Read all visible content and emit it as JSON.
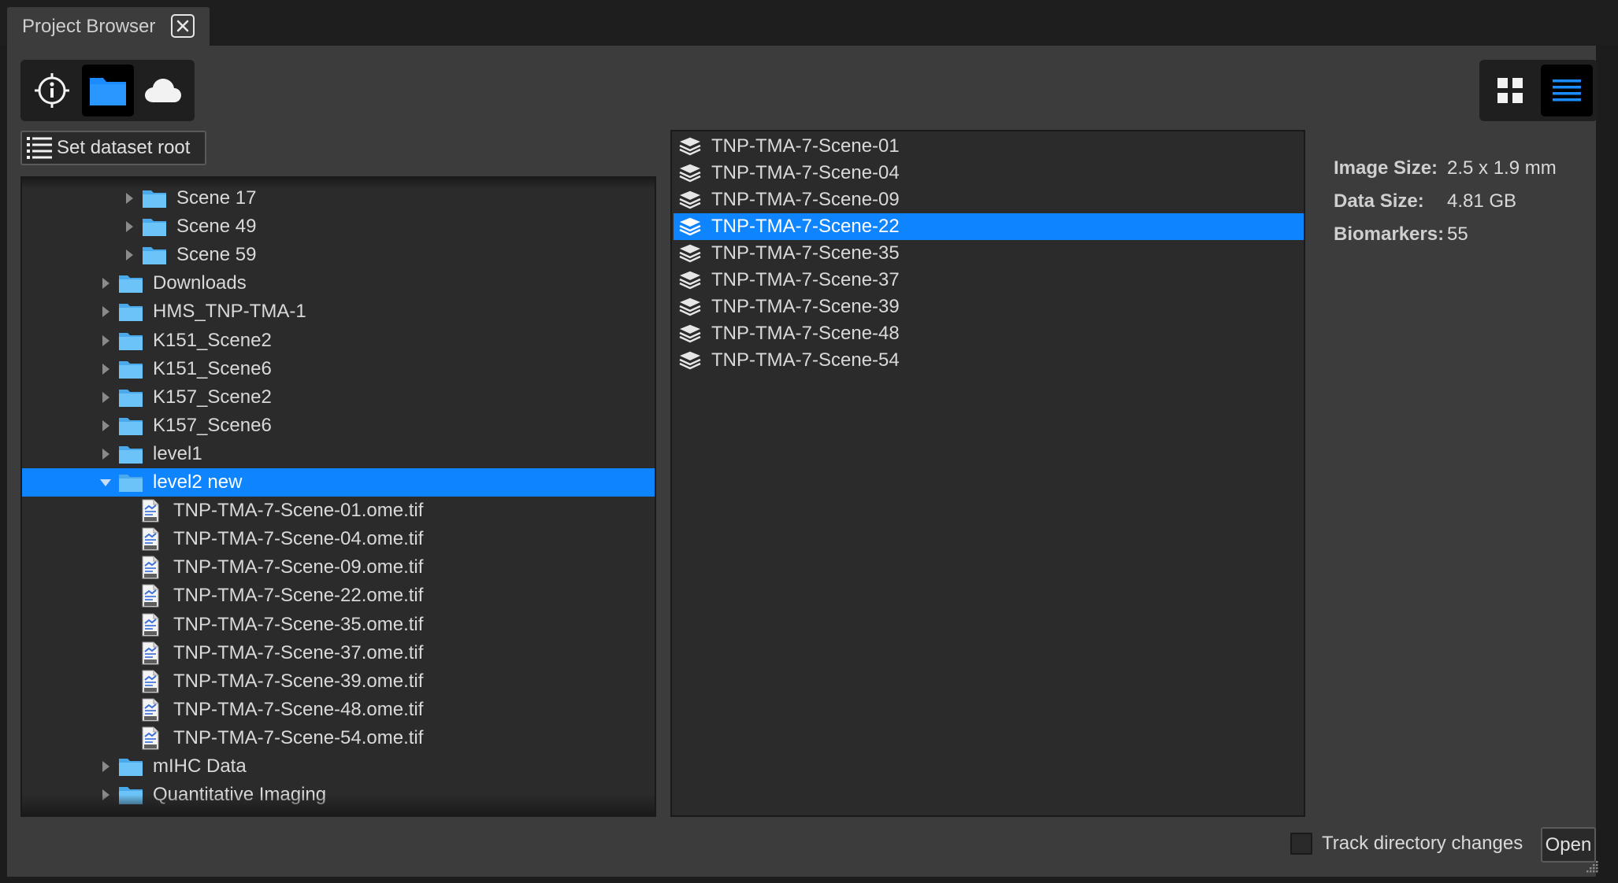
{
  "tab": {
    "title": "Project Browser"
  },
  "toolbar": {
    "modes": [
      {
        "icon": "info-target-icon",
        "active": false
      },
      {
        "icon": "folder-icon",
        "active": true
      },
      {
        "icon": "cloud-icon",
        "active": false
      }
    ],
    "views": [
      {
        "icon": "grid-view-icon",
        "active": false
      },
      {
        "icon": "list-view-icon",
        "active": true
      }
    ],
    "set_root_label": "Set dataset root"
  },
  "tree": {
    "items": [
      {
        "label": "Scene 17",
        "type": "folder",
        "depth": 2,
        "expanded": false,
        "selected": false
      },
      {
        "label": "Scene 49",
        "type": "folder",
        "depth": 2,
        "expanded": false,
        "selected": false
      },
      {
        "label": "Scene 59",
        "type": "folder",
        "depth": 2,
        "expanded": false,
        "selected": false
      },
      {
        "label": "Downloads",
        "type": "folder",
        "depth": 1,
        "expanded": false,
        "selected": false
      },
      {
        "label": "HMS_TNP-TMA-1",
        "type": "folder",
        "depth": 1,
        "expanded": false,
        "selected": false
      },
      {
        "label": "K151_Scene2",
        "type": "folder",
        "depth": 1,
        "expanded": false,
        "selected": false
      },
      {
        "label": "K151_Scene6",
        "type": "folder",
        "depth": 1,
        "expanded": false,
        "selected": false
      },
      {
        "label": "K157_Scene2",
        "type": "folder",
        "depth": 1,
        "expanded": false,
        "selected": false
      },
      {
        "label": "K157_Scene6",
        "type": "folder",
        "depth": 1,
        "expanded": false,
        "selected": false
      },
      {
        "label": "level1",
        "type": "folder",
        "depth": 1,
        "expanded": false,
        "selected": false
      },
      {
        "label": "level2 new",
        "type": "folder",
        "depth": 1,
        "expanded": true,
        "selected": true
      },
      {
        "label": "TNP-TMA-7-Scene-01.ome.tif",
        "type": "file",
        "depth": 2,
        "selected": false
      },
      {
        "label": "TNP-TMA-7-Scene-04.ome.tif",
        "type": "file",
        "depth": 2,
        "selected": false
      },
      {
        "label": "TNP-TMA-7-Scene-09.ome.tif",
        "type": "file",
        "depth": 2,
        "selected": false
      },
      {
        "label": "TNP-TMA-7-Scene-22.ome.tif",
        "type": "file",
        "depth": 2,
        "selected": false
      },
      {
        "label": "TNP-TMA-7-Scene-35.ome.tif",
        "type": "file",
        "depth": 2,
        "selected": false
      },
      {
        "label": "TNP-TMA-7-Scene-37.ome.tif",
        "type": "file",
        "depth": 2,
        "selected": false
      },
      {
        "label": "TNP-TMA-7-Scene-39.ome.tif",
        "type": "file",
        "depth": 2,
        "selected": false
      },
      {
        "label": "TNP-TMA-7-Scene-48.ome.tif",
        "type": "file",
        "depth": 2,
        "selected": false
      },
      {
        "label": "TNP-TMA-7-Scene-54.ome.tif",
        "type": "file",
        "depth": 2,
        "selected": false
      },
      {
        "label": "mIHC Data",
        "type": "folder",
        "depth": 1,
        "expanded": false,
        "selected": false
      },
      {
        "label": "Quantitative Imaging",
        "type": "folder",
        "depth": 1,
        "expanded": false,
        "selected": false
      }
    ]
  },
  "list": {
    "items": [
      {
        "label": "TNP-TMA-7-Scene-01",
        "selected": false
      },
      {
        "label": "TNP-TMA-7-Scene-04",
        "selected": false
      },
      {
        "label": "TNP-TMA-7-Scene-09",
        "selected": false
      },
      {
        "label": "TNP-TMA-7-Scene-22",
        "selected": true
      },
      {
        "label": "TNP-TMA-7-Scene-35",
        "selected": false
      },
      {
        "label": "TNP-TMA-7-Scene-37",
        "selected": false
      },
      {
        "label": "TNP-TMA-7-Scene-39",
        "selected": false
      },
      {
        "label": "TNP-TMA-7-Scene-48",
        "selected": false
      },
      {
        "label": "TNP-TMA-7-Scene-54",
        "selected": false
      }
    ]
  },
  "info": {
    "image_size_label": "Image Size:",
    "image_size_value": "2.5 x 1.9 mm",
    "data_size_label": "Data Size:",
    "data_size_value": "4.81 GB",
    "biomarkers_label": "Biomarkers:",
    "biomarkers_value": "55"
  },
  "footer": {
    "track_label": "Track directory changes",
    "track_checked": false,
    "open_label": "Open"
  },
  "colors": {
    "accent": "#0f84ff",
    "folder": "#5cb8f5",
    "panel": "#3c3c3c",
    "well": "#2b2b2b"
  }
}
